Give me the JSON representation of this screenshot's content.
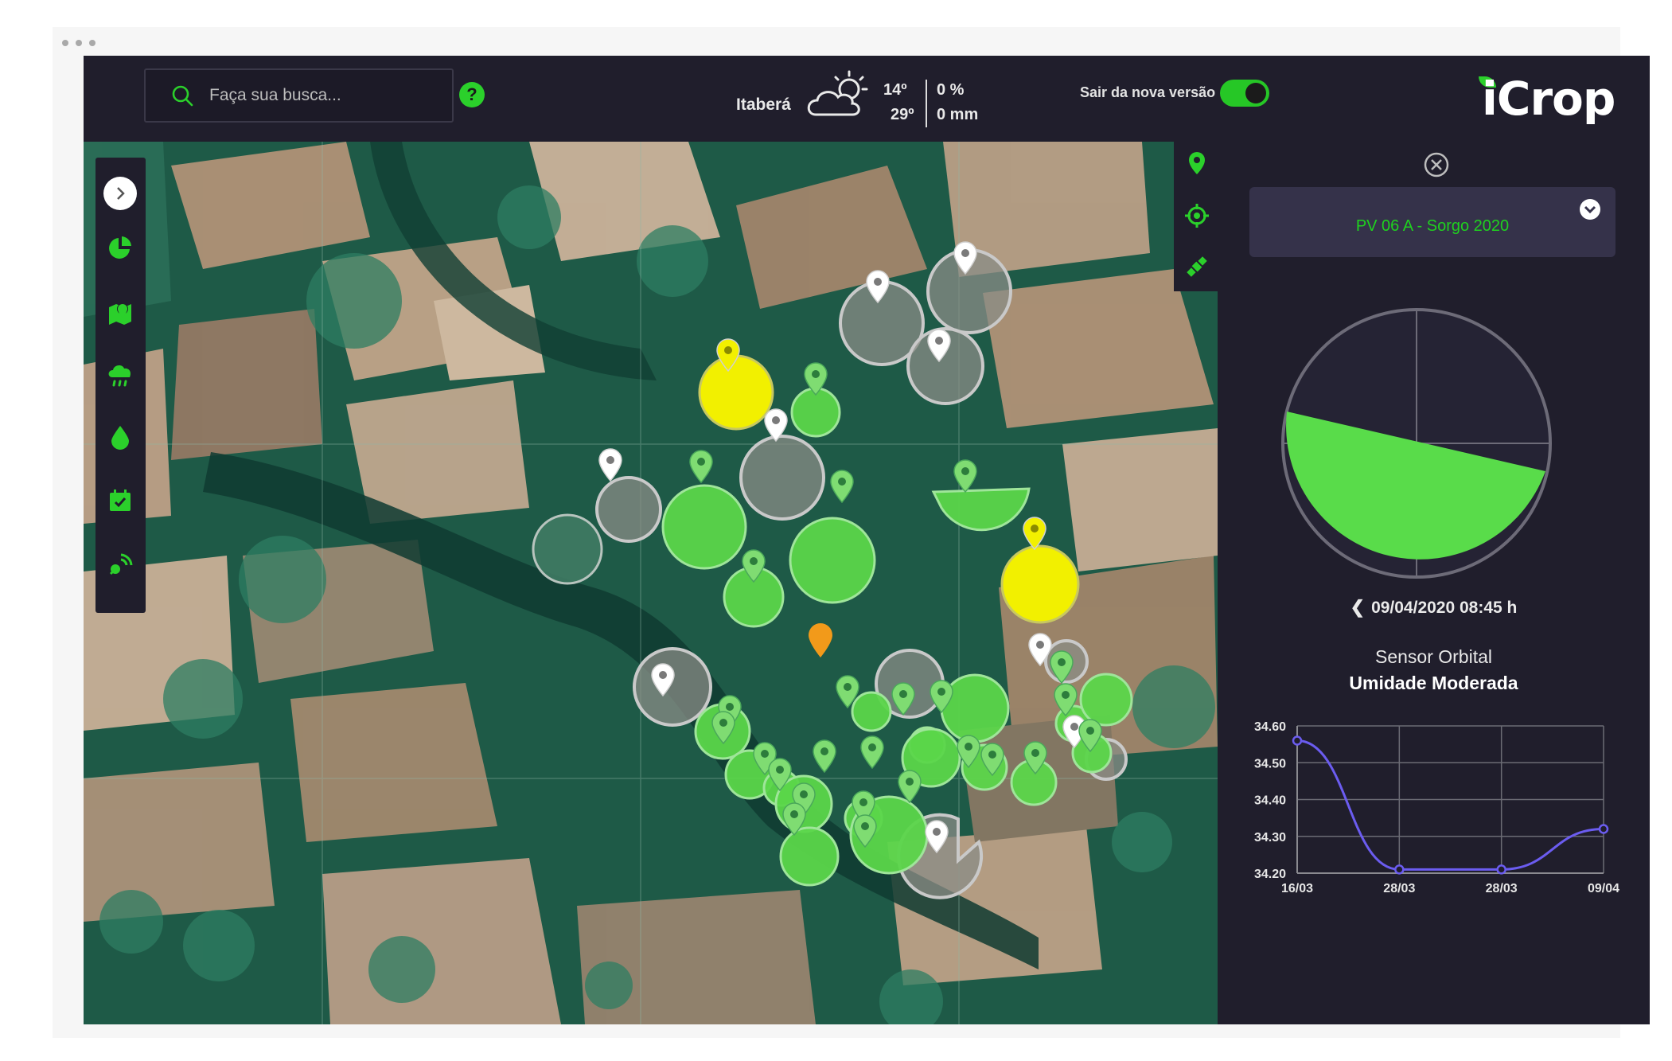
{
  "header": {
    "search_placeholder": "Faça sua busca...",
    "help": "?",
    "weather": {
      "city": "Itaberá",
      "temp_max": "14º",
      "temp_min": "29º",
      "rain_percent": "0 %",
      "rain_mm": "0 mm"
    },
    "toggle_label": "Sair da nova versão",
    "toggle_on": true,
    "logo": "iCrop"
  },
  "sidebar": {
    "items": [
      {
        "icon": "chevron-right-icon"
      },
      {
        "icon": "pie-chart-icon"
      },
      {
        "icon": "map-pin-icon"
      },
      {
        "icon": "rain-cloud-icon"
      },
      {
        "icon": "water-drop-icon"
      },
      {
        "icon": "calendar-check-icon"
      },
      {
        "icon": "satellite-icon"
      }
    ]
  },
  "map_actions": {
    "items": [
      {
        "icon": "location-pin-icon"
      },
      {
        "icon": "crosshair-icon"
      },
      {
        "icon": "satellite-icon"
      }
    ]
  },
  "panel": {
    "field_name": "PV 06 A - Sorgo 2020",
    "date": "09/04/2020 08:45 h",
    "sensor": "Sensor Orbital",
    "status": "Umidade Moderada"
  },
  "chart_data": {
    "type": "line",
    "x": [
      "16/03",
      "28/03",
      "28/03",
      "09/04"
    ],
    "series": [
      {
        "values": [
          34.56,
          34.21,
          34.21,
          34.32
        ]
      }
    ],
    "yticks": [
      "34.60",
      "34.50",
      "34.40",
      "34.30",
      "34.20"
    ],
    "ylim": [
      34.2,
      34.6
    ],
    "grid": true,
    "color": "#6b5cf0"
  },
  "colors": {
    "bg": "#201e2c",
    "accent": "#2bd02b",
    "pivot_green": "#5fd94e",
    "pivot_yellow": "#f2f000",
    "pivot_grey": "#7d8a82"
  }
}
